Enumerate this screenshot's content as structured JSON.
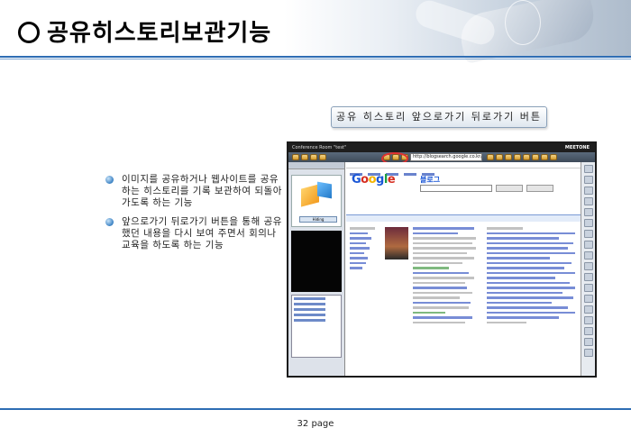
{
  "title": "공유히스토리보관기능",
  "callout": "공유 히스토리 앞으로가기 뒤로가기 버튼",
  "bullets": [
    "이미지를 공유하거나 웹사이트를 공유하는 히스토리를 기록 보관하여 되돌아 가도록 하는 기능",
    "앞으로가기 뒤로가기 버튼을 통해 공유했던 내용을 다시 보여 주면서 회의나 교육을 하도록 하는 기능"
  ],
  "screenshot": {
    "window_title": "Conference Room \"test\"",
    "brand": "MEETONE",
    "url": "http://blogsearch.google.co.kr/?hl=",
    "logo_letters": [
      "G",
      "o",
      "o",
      "g",
      "l",
      "e"
    ],
    "logo_suffix": "블로그",
    "viewer_button": "Hiding",
    "colors": {
      "highlight": "#e03030",
      "google_blue": "#1a56d6"
    }
  },
  "page_number": "32 page"
}
